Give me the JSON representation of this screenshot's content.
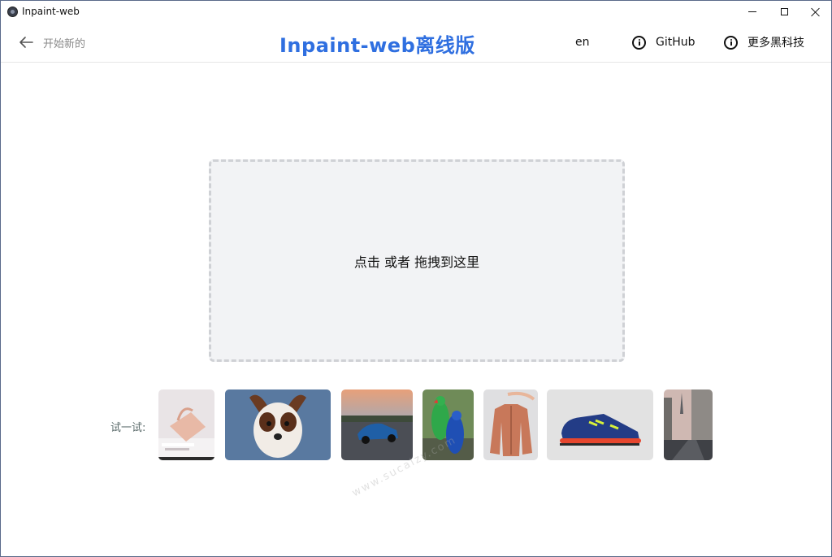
{
  "window": {
    "title": "Inpaint-web"
  },
  "header": {
    "back_label": "开始新的",
    "brand": "Inpaint-web离线版",
    "brand_color": "#2f6fe0",
    "lang": "en",
    "links": [
      {
        "label": "GitHub",
        "icon": "info-icon"
      },
      {
        "label": "更多黑科技",
        "icon": "info-icon"
      }
    ]
  },
  "dropzone": {
    "label": "点击 或者 拖拽到这里"
  },
  "examples": {
    "label": "试一试:",
    "items": [
      {
        "name": "bag-example"
      },
      {
        "name": "dog-example"
      },
      {
        "name": "car-example"
      },
      {
        "name": "parrots-example"
      },
      {
        "name": "jacket-example"
      },
      {
        "name": "sneaker-example"
      },
      {
        "name": "street-example"
      }
    ]
  },
  "watermark": "www.sucaizy.com"
}
